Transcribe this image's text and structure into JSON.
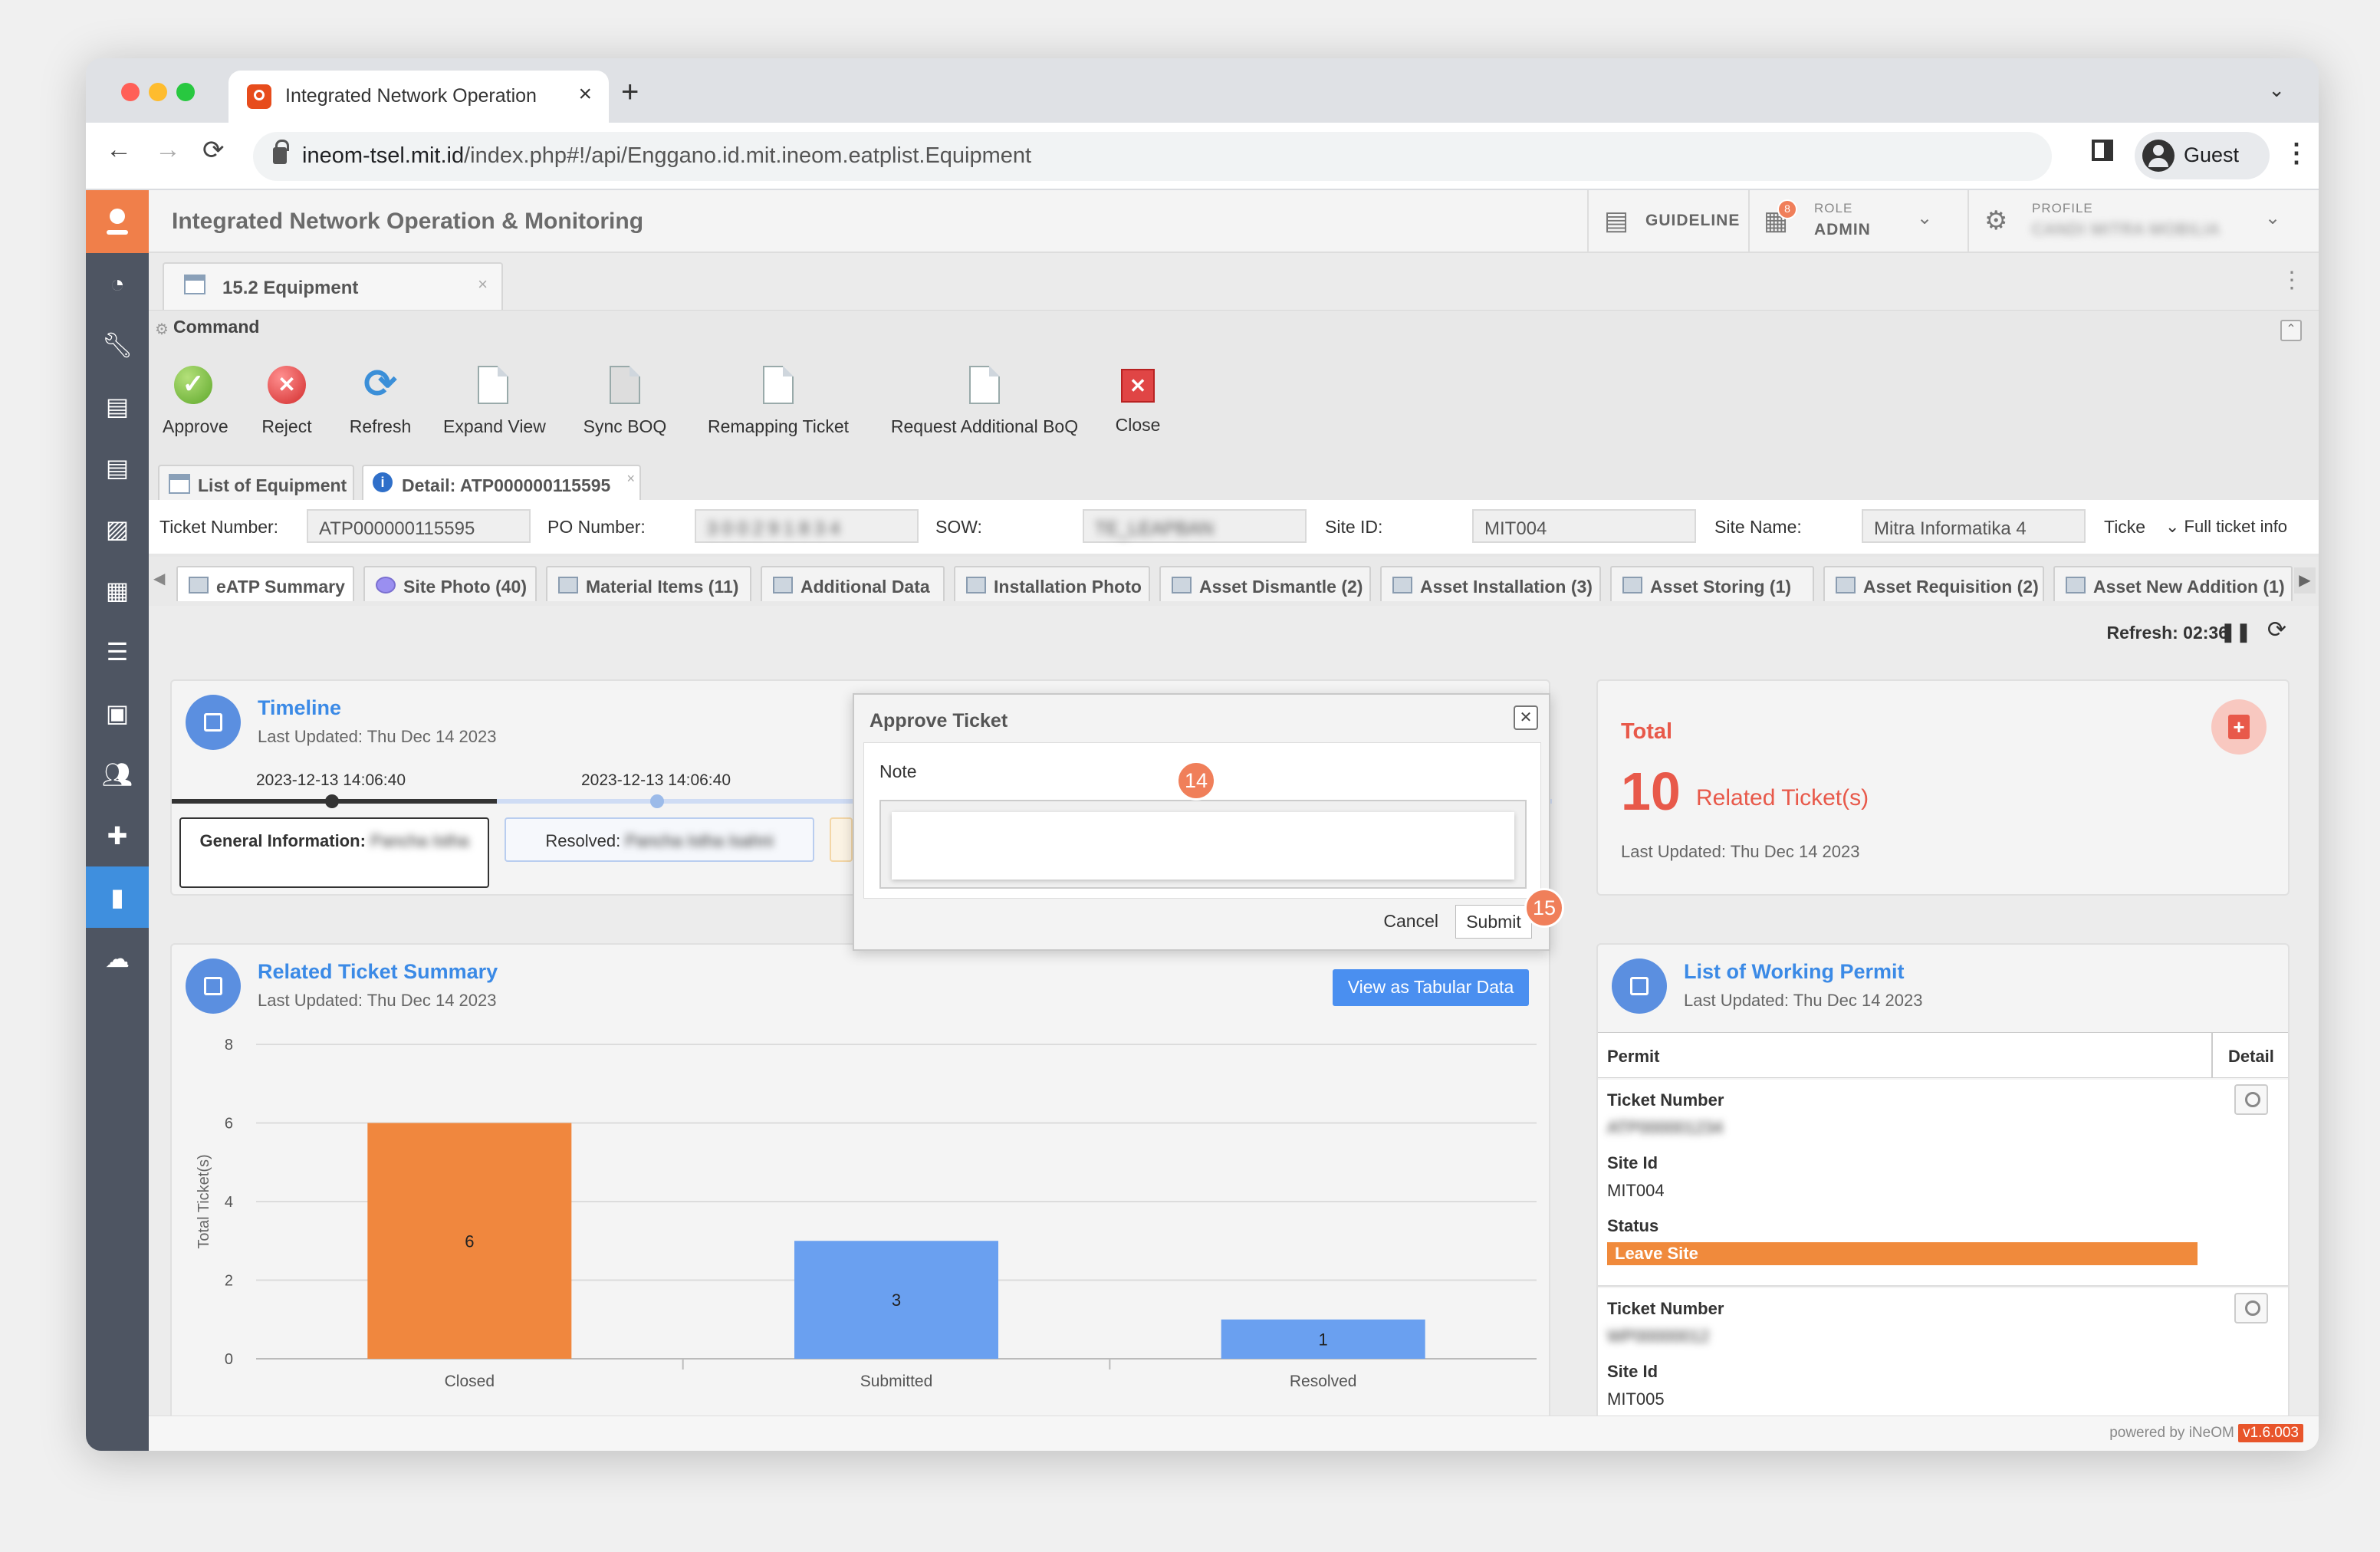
{
  "browser": {
    "tab_title": "Integrated Network Operation",
    "url_host": "ineom-tsel.mit.id",
    "url_path": "/index.php#!/api/Enggano.id.mit.ineom.eatplist.Equipment",
    "profile_label": "Guest",
    "new_tab": "+",
    "tab_close": "×"
  },
  "app": {
    "title": "Integrated Network Operation & Monitoring",
    "guideline": "GUIDELINE",
    "role_small": "ROLE",
    "role_value": "ADMIN",
    "role_badge": "8",
    "profile_small": "PROFILE",
    "profile_value": "CANDI MITRA MOBILIA"
  },
  "doc_tab": {
    "label": "15.2 Equipment",
    "close": "×"
  },
  "command": {
    "title": "Command",
    "buttons": [
      {
        "label": "Approve"
      },
      {
        "label": "Reject"
      },
      {
        "label": "Refresh"
      },
      {
        "label": "Expand View"
      },
      {
        "label": "Sync BOQ"
      },
      {
        "label": "Remapping Ticket"
      },
      {
        "label": "Request Additional BoQ"
      },
      {
        "label": "Close"
      }
    ]
  },
  "sub_tabs": [
    {
      "label": "List of Equipment"
    },
    {
      "label": "Detail: ATP000000115595"
    }
  ],
  "ticket_info": {
    "ticket_number_label": "Ticket Number:",
    "ticket_number": "ATP000000115595",
    "po_number_label": "PO Number:",
    "po_number": "3 0 0 2 9 1 8 3 4",
    "sow_label": "SOW:",
    "sow": "TE_LEAPBAN",
    "site_id_label": "Site ID:",
    "site_id": "MIT004",
    "site_name_label": "Site Name:",
    "site_name": "Mitra Informatika 4",
    "ticket_trunc": "Ticke",
    "full_info": "Full ticket info"
  },
  "page_tabs": [
    {
      "label": "eATP Summary"
    },
    {
      "label": "Site Photo (40)"
    },
    {
      "label": "Material Items (11)"
    },
    {
      "label": "Additional Data"
    },
    {
      "label": "Installation Photo"
    },
    {
      "label": "Asset Dismantle (2)"
    },
    {
      "label": "Asset Installation (3)"
    },
    {
      "label": "Asset Storing (1)"
    },
    {
      "label": "Asset Requisition (2)"
    },
    {
      "label": "Asset New Addition (1)"
    }
  ],
  "refresh": {
    "label": "Refresh: 02:36"
  },
  "timeline": {
    "title": "Timeline",
    "updated": "Last Updated: Thu Dec 14 2023",
    "dates": [
      "2023-12-13 14:06:40",
      "2023-12-13 14:06:40"
    ],
    "items": [
      {
        "label": "General Information:",
        "value": "Pancha Istha"
      },
      {
        "label": "Resolved:",
        "value": "Pancha Istha Isahni"
      }
    ]
  },
  "modal": {
    "title": "Approve Ticket",
    "note_label": "Note",
    "note_value": "",
    "cancel": "Cancel",
    "submit": "Submit",
    "close": "✕",
    "step_a": "14",
    "step_b": "15"
  },
  "total": {
    "title": "Total",
    "count": "10",
    "count_label": "Related Ticket(s)",
    "updated": "Last Updated: Thu Dec 14 2023"
  },
  "summary": {
    "title": "Related Ticket Summary",
    "updated": "Last Updated: Thu Dec 14 2023",
    "tabular_button": "View as Tabular Data"
  },
  "chart_data": {
    "type": "bar",
    "categories": [
      "Closed",
      "Submitted",
      "Resolved"
    ],
    "values": [
      6,
      3,
      1
    ],
    "colors": [
      "#f0873e",
      "#6aa0f0",
      "#6aa0f0"
    ],
    "ylabel": "Total Ticket(s)",
    "ylim": [
      0,
      8
    ],
    "yticks": [
      "0",
      "2",
      "4",
      "6",
      "8"
    ],
    "grid": true
  },
  "permits": {
    "title": "List of Working Permit",
    "updated": "Last Updated: Thu Dec 14 2023",
    "col_permit": "Permit",
    "col_detail": "Detail",
    "entries": [
      {
        "ticket_label": "Ticket Number",
        "ticket_value": "ATP000001234",
        "site_label": "Site Id",
        "site_value": "MIT004",
        "status_label": "Status",
        "status_value": "Leave Site"
      },
      {
        "ticket_label": "Ticket Number",
        "ticket_value": "WP00000012",
        "site_label": "Site Id",
        "site_value": "MIT005"
      }
    ]
  },
  "footer": {
    "text": "powered by iNeOM",
    "version": "v1.6.003"
  }
}
